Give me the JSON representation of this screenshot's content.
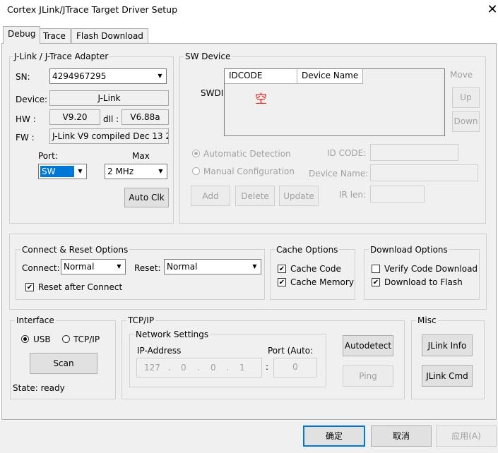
{
  "window": {
    "title": "Cortex JLink/JTrace Target Driver Setup",
    "close_glyph": "✕"
  },
  "tabs": [
    "Debug",
    "Trace",
    "Flash Download"
  ],
  "adapter": {
    "group_label": "J-Link / J-Trace Adapter",
    "sn_label": "SN:",
    "sn_value": "4294967295",
    "device_label": "Device:",
    "device_value": "J-Link",
    "hw_label": "HW :",
    "hw_value": "V9.20",
    "dll_label": "dll :",
    "dll_value": "V6.88a",
    "fw_label": "FW :",
    "fw_value": "J-Link V9 compiled Dec 13 2",
    "port_label": "Port:",
    "port_value": "SW",
    "max_label": "Max",
    "max_value": "2 MHz",
    "auto_clk": "Auto Clk"
  },
  "sw_device": {
    "group_label": "SW Device",
    "swdi_label": "SWDI",
    "col_idcode": "IDCODE",
    "col_device_name": "Device Name",
    "empty_text": "空",
    "move_label": "Move",
    "up": "Up",
    "down": "Down",
    "auto_detect": "Automatic Detection",
    "manual_config": "Manual Configuration",
    "id_code_label": "ID CODE:",
    "device_name_label": "Device Name:",
    "ir_len_label": "IR len:",
    "add": "Add",
    "delete": "Delete",
    "update": "Update"
  },
  "connect_reset": {
    "group_label": "Connect & Reset Options",
    "connect_label": "Connect:",
    "connect_value": "Normal",
    "reset_label": "Reset:",
    "reset_value": "Normal",
    "reset_after_connect": "Reset after Connect"
  },
  "cache": {
    "group_label": "Cache Options",
    "cache_code": "Cache Code",
    "cache_memory": "Cache Memory"
  },
  "download": {
    "group_label": "Download Options",
    "verify": "Verify Code Download",
    "to_flash": "Download to Flash"
  },
  "interface": {
    "group_label": "Interface",
    "usb": "USB",
    "tcpip": "TCP/IP",
    "scan": "Scan",
    "state": "State: ready"
  },
  "tcpip": {
    "group_label": "TCP/IP",
    "network_label": "Network Settings",
    "ip_label": "IP-Address",
    "port_label": "Port (Auto:",
    "ip": [
      "127",
      "0",
      "0",
      "1"
    ],
    "dot": ".",
    "colon": ":",
    "port_value": "0",
    "autodetect": "Autodetect",
    "ping": "Ping"
  },
  "misc": {
    "group_label": "Misc",
    "jlink_info": "JLink Info",
    "jlink_cmd": "JLink Cmd"
  },
  "footer": {
    "ok": "确定",
    "cancel": "取消",
    "apply": "应用(A)"
  },
  "colors": {
    "accent": "#0078d7",
    "empty_text": "#e0201b",
    "panel_bg": "#f0f0f0"
  },
  "icons": {
    "check": "✔",
    "dropdown": "▼"
  }
}
